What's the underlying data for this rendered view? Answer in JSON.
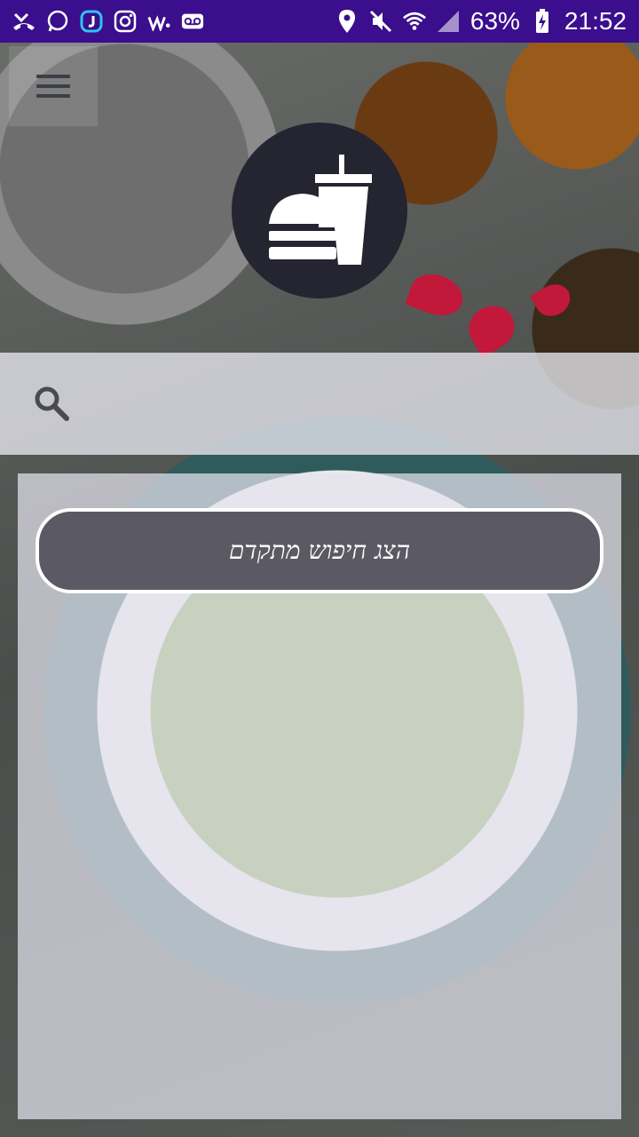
{
  "status_bar": {
    "battery_percent": "63%",
    "time": "21:52",
    "left_icons": [
      "missed-call-icon",
      "whatsapp-icon",
      "app-j-icon",
      "instagram-icon",
      "waze-icon",
      "voicemail-icon"
    ],
    "right_icons": [
      "location-icon",
      "mute-icon",
      "wifi-icon",
      "signal-icon",
      "battery-icon"
    ]
  },
  "header": {
    "menu_icon": "hamburger-menu-icon",
    "logo_icon": "burger-drink-logo-icon"
  },
  "search": {
    "icon": "search-icon",
    "placeholder": ""
  },
  "panel": {
    "advanced_search_label": "הצג חיפוש מתקדם"
  },
  "colors": {
    "status_bar": "#3a0e8c",
    "logo_bg": "#252431",
    "button_bg": "#5b5963"
  }
}
